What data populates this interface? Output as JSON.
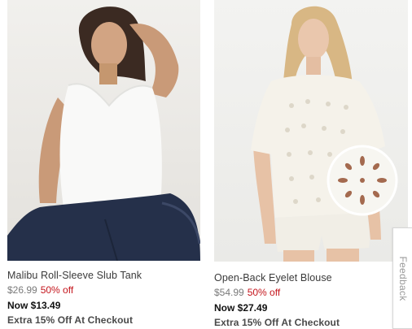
{
  "products": [
    {
      "name": "Malibu Roll-Sleeve Slub Tank",
      "original_price": "$26.99",
      "discount": "50% off",
      "now_price": "Now $13.49",
      "promo": "Extra 15% Off At Checkout"
    },
    {
      "name": "Open-Back Eyelet Blouse",
      "original_price": "$54.99",
      "discount": "50% off",
      "now_price": "Now $27.49",
      "promo": "Extra 15% Off At Checkout"
    }
  ],
  "feedback": {
    "label": "Feedback"
  },
  "colors": {
    "sale": "#c4151c",
    "text": "#333333",
    "muted": "#7a7a7a"
  }
}
